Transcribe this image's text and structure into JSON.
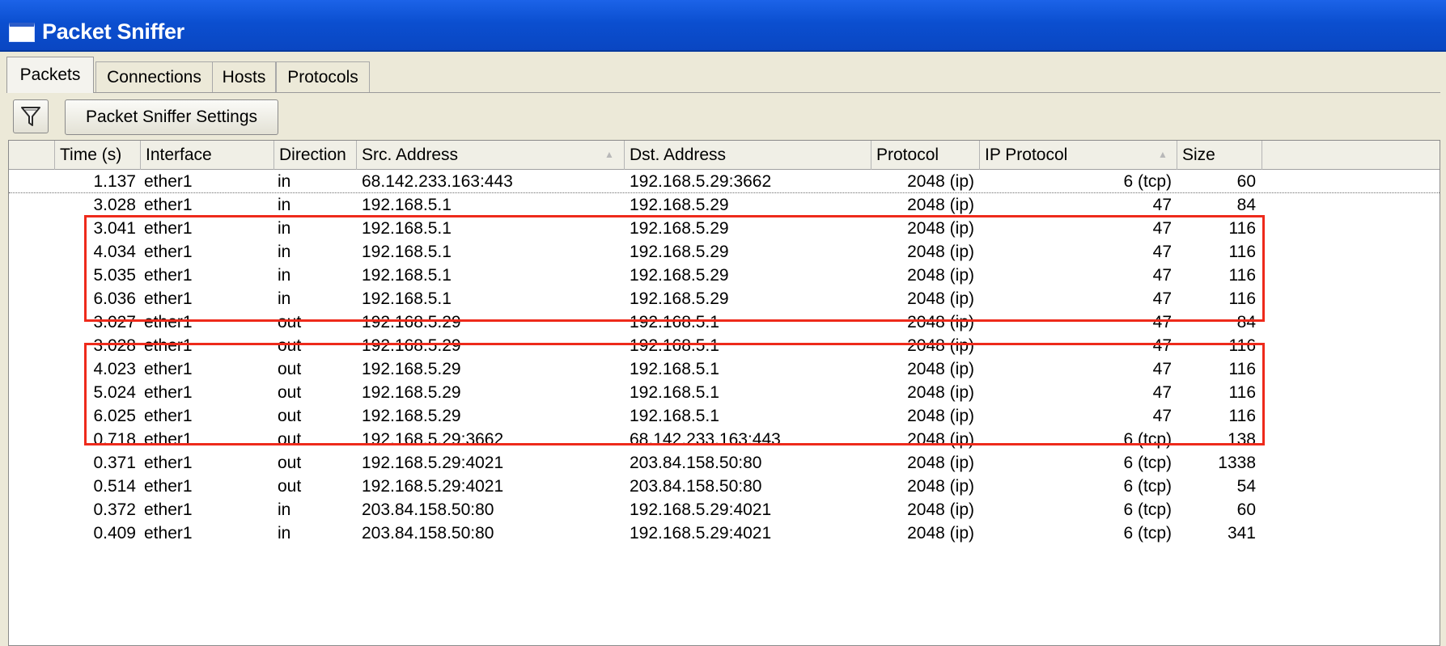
{
  "window": {
    "title": "Packet Sniffer"
  },
  "tabs": [
    {
      "label": "Packets",
      "active": true
    },
    {
      "label": "Connections",
      "active": false
    },
    {
      "label": "Hosts",
      "active": false
    },
    {
      "label": "Protocols",
      "active": false
    }
  ],
  "toolbar": {
    "filter_icon": "filter-icon",
    "settings_label": "Packet Sniffer Settings"
  },
  "table": {
    "columns": [
      "Time (s)",
      "Interface",
      "Direction",
      "Src. Address",
      "Dst. Address",
      "Protocol",
      "IP Protocol",
      "Size"
    ],
    "rows": [
      [
        "1.137",
        "ether1",
        "in",
        "68.142.233.163:443",
        "192.168.5.29:3662",
        "2048 (ip)",
        "6 (tcp)",
        "60"
      ],
      [
        "3.028",
        "ether1",
        "in",
        "192.168.5.1",
        "192.168.5.29",
        "2048 (ip)",
        "47",
        "84"
      ],
      [
        "3.041",
        "ether1",
        "in",
        "192.168.5.1",
        "192.168.5.29",
        "2048 (ip)",
        "47",
        "116"
      ],
      [
        "4.034",
        "ether1",
        "in",
        "192.168.5.1",
        "192.168.5.29",
        "2048 (ip)",
        "47",
        "116"
      ],
      [
        "5.035",
        "ether1",
        "in",
        "192.168.5.1",
        "192.168.5.29",
        "2048 (ip)",
        "47",
        "116"
      ],
      [
        "6.036",
        "ether1",
        "in",
        "192.168.5.1",
        "192.168.5.29",
        "2048 (ip)",
        "47",
        "116"
      ],
      [
        "3.027",
        "ether1",
        "out",
        "192.168.5.29",
        "192.168.5.1",
        "2048 (ip)",
        "47",
        "84"
      ],
      [
        "3.028",
        "ether1",
        "out",
        "192.168.5.29",
        "192.168.5.1",
        "2048 (ip)",
        "47",
        "116"
      ],
      [
        "4.023",
        "ether1",
        "out",
        "192.168.5.29",
        "192.168.5.1",
        "2048 (ip)",
        "47",
        "116"
      ],
      [
        "5.024",
        "ether1",
        "out",
        "192.168.5.29",
        "192.168.5.1",
        "2048 (ip)",
        "47",
        "116"
      ],
      [
        "6.025",
        "ether1",
        "out",
        "192.168.5.29",
        "192.168.5.1",
        "2048 (ip)",
        "47",
        "116"
      ],
      [
        "0.718",
        "ether1",
        "out",
        "192.168.5.29:3662",
        "68.142.233.163:443",
        "2048 (ip)",
        "6 (tcp)",
        "138"
      ],
      [
        "0.371",
        "ether1",
        "out",
        "192.168.5.29:4021",
        "203.84.158.50:80",
        "2048 (ip)",
        "6 (tcp)",
        "1338"
      ],
      [
        "0.514",
        "ether1",
        "out",
        "192.168.5.29:4021",
        "203.84.158.50:80",
        "2048 (ip)",
        "6 (tcp)",
        "54"
      ],
      [
        "0.372",
        "ether1",
        "in",
        "203.84.158.50:80",
        "192.168.5.29:4021",
        "2048 (ip)",
        "6 (tcp)",
        "60"
      ],
      [
        "0.409",
        "ether1",
        "in",
        "203.84.158.50:80",
        "192.168.5.29:4021",
        "2048 (ip)",
        "6 (tcp)",
        "341"
      ]
    ]
  },
  "highlight_color": "#ee2a1b"
}
